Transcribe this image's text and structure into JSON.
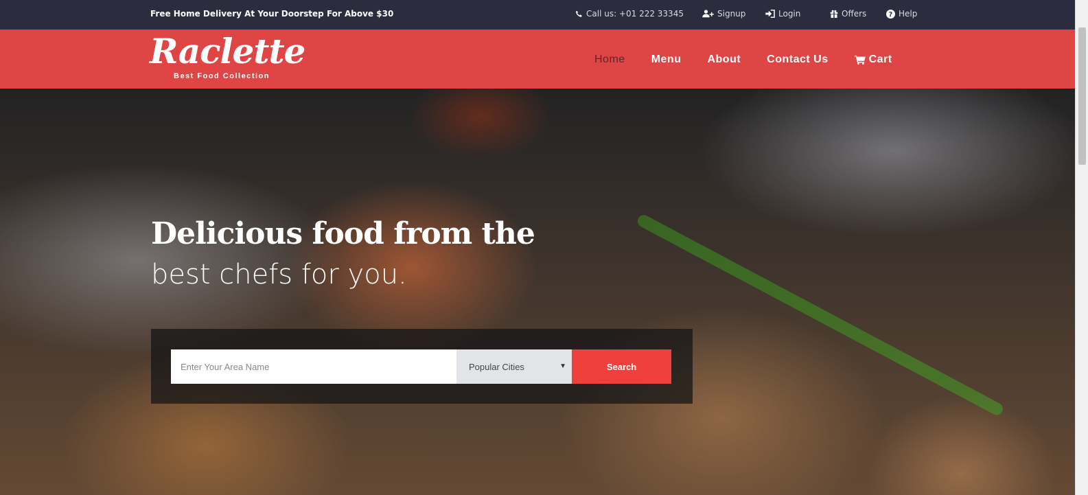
{
  "topbar": {
    "promo": "Free Home Delivery At Your Doorstep For Above $30",
    "call": "Call us: +01 222 33345",
    "signup": "Signup",
    "login": "Login",
    "offers": "Offers",
    "help": "Help"
  },
  "header": {
    "brand": "Raclette",
    "tagline": "Best Food Collection",
    "nav": {
      "home": "Home",
      "menu": "Menu",
      "about": "About",
      "contact": "Contact Us",
      "cart": "Cart"
    }
  },
  "hero": {
    "headline_bold": "Delicious food from the",
    "headline_light": "best chefs for you.",
    "search": {
      "placeholder": "Enter Your Area Name",
      "city_selected": "Popular Cities",
      "button": "Search"
    }
  },
  "colors": {
    "topbar_bg": "#2b2c3d",
    "header_bg": "#e04545",
    "search_button": "#f0403e"
  },
  "icons": [
    "phone-icon",
    "user-plus-icon",
    "sign-in-icon",
    "gift-icon",
    "question-circle-icon",
    "cart-icon",
    "caret-down-icon"
  ]
}
